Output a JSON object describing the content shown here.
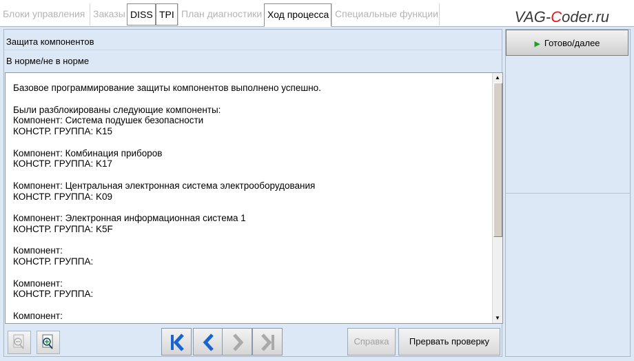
{
  "tabs": [
    {
      "label": "Блоки управления"
    },
    {
      "label": "Заказы"
    },
    {
      "label": "DISS"
    },
    {
      "label": "TPI"
    },
    {
      "label": "План диагностики"
    },
    {
      "label": "Ход процесса"
    },
    {
      "label": "Специальные функции"
    }
  ],
  "logo": {
    "before": "VAG-",
    "c": "C",
    "after": "oder.ru"
  },
  "header": {
    "title": "Защита компонентов",
    "status": "В норме/не в норме"
  },
  "log_text": "Базовое программирование защиты компонентов выполнено успешно.\n\nБыли разблокированы следующие компоненты:\nКомпонент: Система подушек безопасности\nКОНСТР. ГРУППА: K15\n\nКомпонент: Комбинация приборов\nКОНСТР. ГРУППА: K17\n\nКомпонент: Центральная электронная система электрооборудования\nКОНСТР. ГРУППА: K09\n\nКомпонент: Электронная информационная система 1\nКОНСТР. ГРУППА: K5F\n\nКомпонент:\nКОНСТР. ГРУППА:\n\nКомпонент:\nКОНСТР. ГРУППА:\n\nКомпонент:\nКОНСТР. ГРУППА:",
  "buttons": {
    "ready": "Готово/далее",
    "help": "Справка",
    "abort": "Прервать проверку"
  },
  "icons": {
    "zoom_out": "zoom-out-icon",
    "zoom_in": "zoom-in-icon",
    "first": "first-page-icon",
    "back": "back-icon",
    "forward": "forward-icon",
    "last": "last-page-icon",
    "play": "play-icon"
  },
  "colors": {
    "background": "#dce8f5",
    "nav_arrow": "#1a64d0",
    "play": "#20a020",
    "logo_accent": "#e8121a"
  }
}
